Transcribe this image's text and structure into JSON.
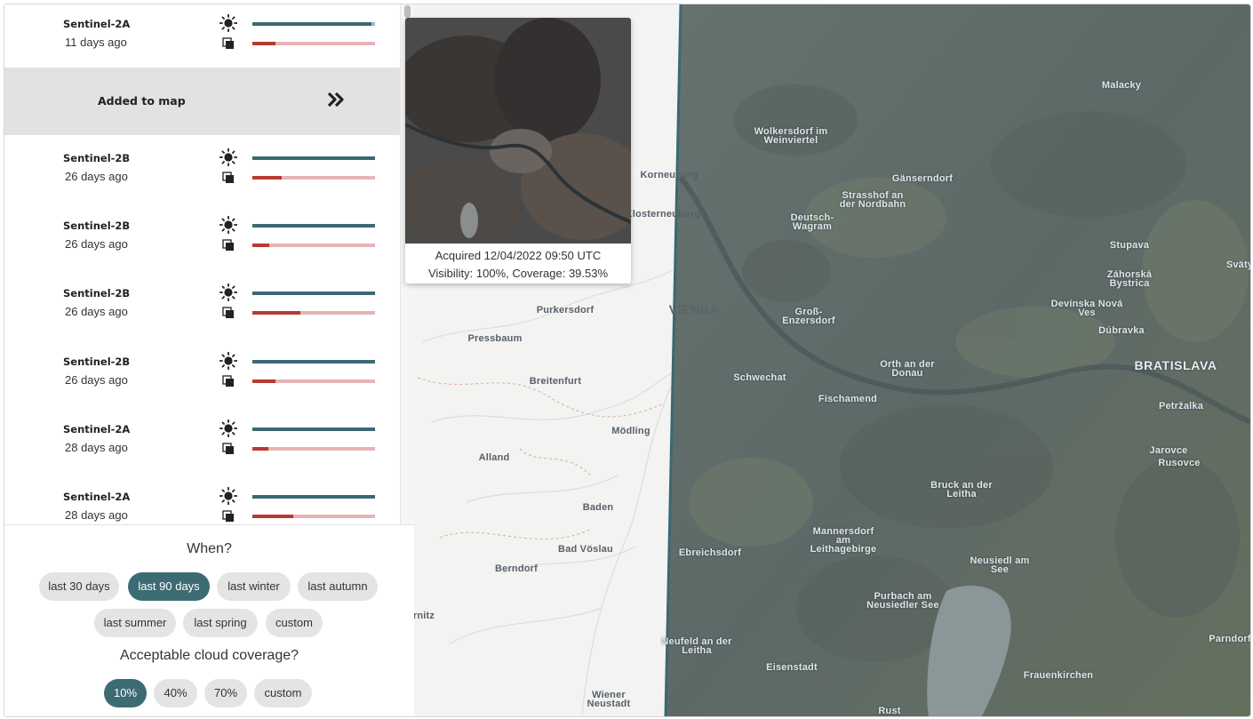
{
  "results": [
    {
      "satellite": "Sentinel-2A",
      "age": "11 days ago",
      "visibility": 0.97,
      "coverage": 0.19
    },
    {
      "satellite": "Sentinel-2B",
      "age": "26 days ago",
      "visibility": 1.0,
      "coverage": 0.24
    },
    {
      "satellite": "Sentinel-2B",
      "age": "26 days ago",
      "visibility": 1.0,
      "coverage": 0.14
    },
    {
      "satellite": "Sentinel-2B",
      "age": "26 days ago",
      "visibility": 1.0,
      "coverage": 0.39
    },
    {
      "satellite": "Sentinel-2B",
      "age": "26 days ago",
      "visibility": 1.0,
      "coverage": 0.19
    },
    {
      "satellite": "Sentinel-2A",
      "age": "28 days ago",
      "visibility": 1.0,
      "coverage": 0.13
    },
    {
      "satellite": "Sentinel-2A",
      "age": "28 days ago",
      "visibility": 1.0,
      "coverage": 0.33
    }
  ],
  "added_to_map": {
    "label": "Added to map",
    "icon": "double-chevron-right-icon"
  },
  "tooltip": {
    "acquired": "Acquired 12/04/2022 09:50 UTC",
    "stats": "Visibility: 100%, Coverage: 39.53%"
  },
  "filters": {
    "when_label": "When?",
    "when_options": [
      "last 30 days",
      "last 90 days",
      "last winter",
      "last autumn",
      "last summer",
      "last spring",
      "custom"
    ],
    "when_selected": "last 90 days",
    "cloud_label": "Acceptable cloud coverage?",
    "cloud_options": [
      "10%",
      "40%",
      "70%",
      "custom"
    ],
    "cloud_selected": "10%"
  },
  "map": {
    "places": [
      "Malacky",
      "Wolkersdorf im\nWeinviertel",
      "Gänserndorf",
      "Korneuburg",
      "Strasshof an\nder Nordbahn",
      "Deutsch-\nWagram",
      "Klosterneuburg",
      "Stupava",
      "Záhorská\nBystrica",
      "Svätý",
      "Devínska Nová\nVes",
      "Purkersdorf",
      "VIENNA",
      "Groß-\nEnzersdorf",
      "Dúbravka",
      "Pressbaum",
      "BRATISLAVA",
      "Orth an der\nDonau",
      "Schwechat",
      "Breitenfurt",
      "Fischamend",
      "Petržalka",
      "Mödling",
      "Jarovce",
      "Rusovce",
      "Alland",
      "Bruck an der\nLeitha",
      "Baden",
      "Mannersdorf\nam\nLeithagebirge",
      "Ebreichsdorf",
      "Bad Vöslau",
      "Neusiedl am\nSee",
      "Berndorf",
      "Purbach am\nNeusiedler See",
      "rnitz",
      "Neufeld an der\nLeitha",
      "Parndorf",
      "Eisenstadt",
      "Frauenkirchen",
      "Wiener\nNeustadt",
      "Rust"
    ],
    "colors": {
      "satellite_tint": "#5f6c6a",
      "basemap": "#f3f3f2",
      "swipe_line": "#3b6872"
    }
  },
  "colors": {
    "accent": "#3d6b73",
    "visibility_bar": "#3b6872",
    "coverage_bar": "#b83a32",
    "coverage_track": "#e8b3b5"
  }
}
